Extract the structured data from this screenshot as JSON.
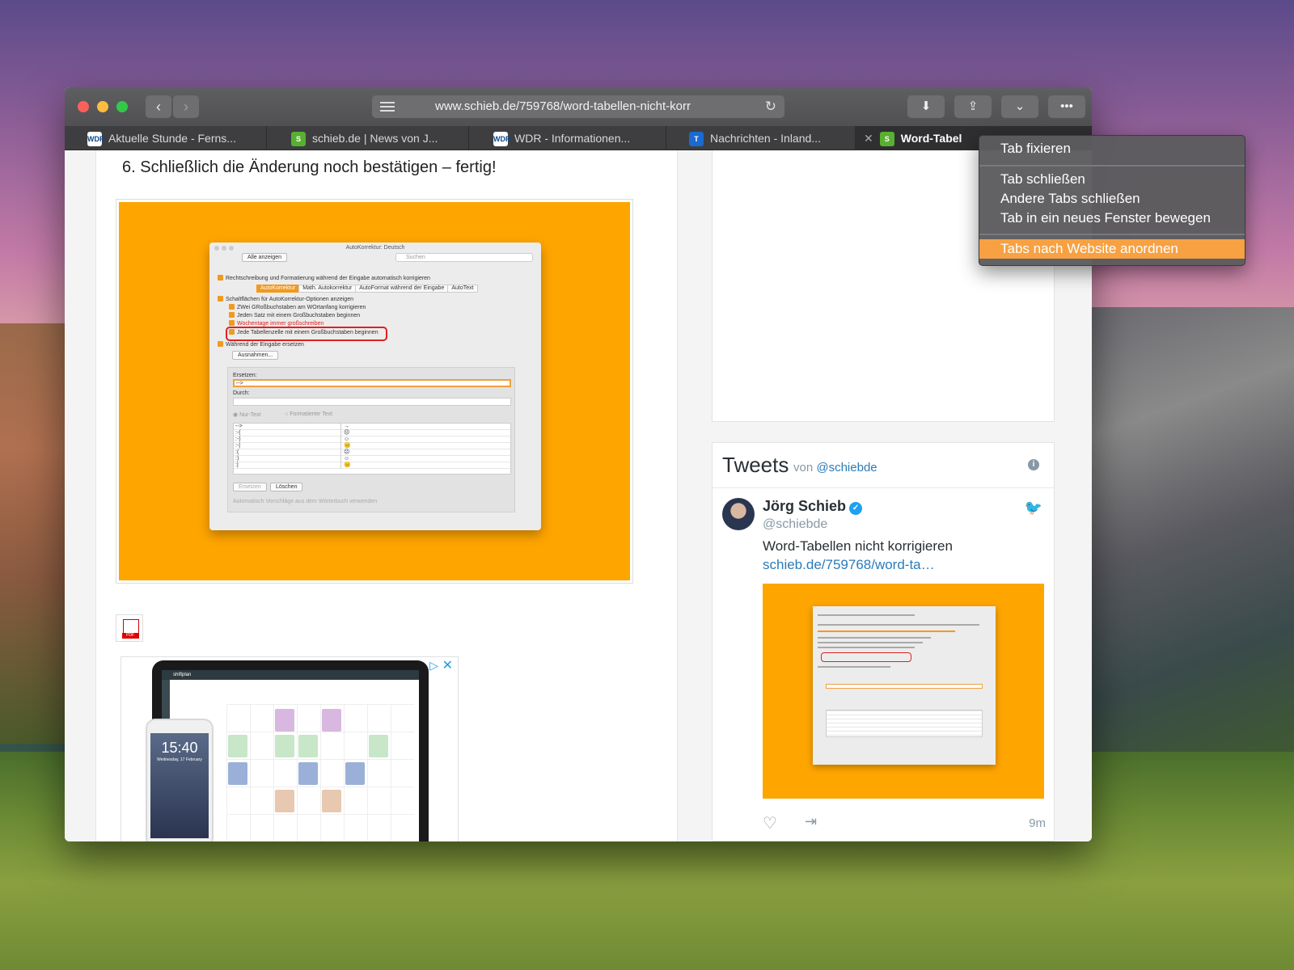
{
  "browser": {
    "url": "www.schieb.de/759768/word-tabellen-nicht-korr",
    "tabs": [
      {
        "label": "Aktuelle Stunde - Ferns...",
        "favicon": "WDR"
      },
      {
        "label": "schieb.de | News von J...",
        "favicon": "S"
      },
      {
        "label": "WDR - Informationen...",
        "favicon": "WDR"
      },
      {
        "label": "Nachrichten - Inland...",
        "favicon": "T"
      },
      {
        "label": "Word-Tabel",
        "favicon": "S"
      }
    ],
    "active_tab_close": "✕"
  },
  "article": {
    "step": "6.  Schließlich die Änderung noch bestätigen – fertig!",
    "dialog": {
      "title": "AutoKorrektur: Deutsch",
      "show_all": "Alle anzeigen",
      "search_placeholder": "Suchen",
      "line1": "Rechtschreibung und Formatierung während der Eingabe automatisch korrigieren",
      "tabs": [
        "AutoKorrektur",
        "Math. Autokorrektur",
        "AutoFormat während der Eingabe",
        "AutoText"
      ],
      "options": [
        "Schaltflächen für AutoKorrektur-Optionen anzeigen",
        "ZWei GRoßbuchstaben am WOrtanfang korrigieren",
        "Jeden Satz mit einem Großbuchstaben beginnen",
        "Wochentage immer großschreiben",
        "Jede Tabellenzelle mit einem Großbuchstaben beginnen",
        "Während der Eingabe ersetzen"
      ],
      "exceptions_button": "Ausnahmen...",
      "replace_label": "Ersetzen:",
      "replace_value": "-->",
      "with_label": "Durch:",
      "radio_plain": "Nur-Text",
      "radio_formatted": "Formatierter Text",
      "table_rows": [
        [
          "-->",
          "→"
        ],
        [
          ":-(",
          "☹"
        ],
        [
          ":-)",
          "☺"
        ],
        [
          ":-|",
          "😐"
        ],
        [
          ":(",
          "☹"
        ],
        [
          ":)",
          "☺"
        ],
        [
          ":|",
          "😐"
        ]
      ],
      "replace_button": "Ersetzen",
      "delete_button": "Löschen",
      "footer": "Automatisch Vorschläge aus dem Wörterbuch verwenden"
    },
    "ad": {
      "brand": "shiftplan",
      "phone_time": "15:40",
      "phone_date": "Wednesday, 17 February"
    }
  },
  "tweets": {
    "title": "Tweets",
    "von": "von",
    "handle_link": "@schiebde",
    "info": "i",
    "author_name": "Jörg Schieb",
    "author_handle": "@schiebde",
    "text": "Word-Tabellen nicht korrigieren",
    "link": "schieb.de/759768/word-ta…",
    "time": "9m"
  },
  "context_menu": {
    "items": [
      "Tab fixieren",
      "Tab schließen",
      "Andere Tabs schließen",
      "Tab in ein neues Fenster bewegen",
      "Tabs nach Website anordnen"
    ],
    "highlight_color": "#f7a143"
  }
}
